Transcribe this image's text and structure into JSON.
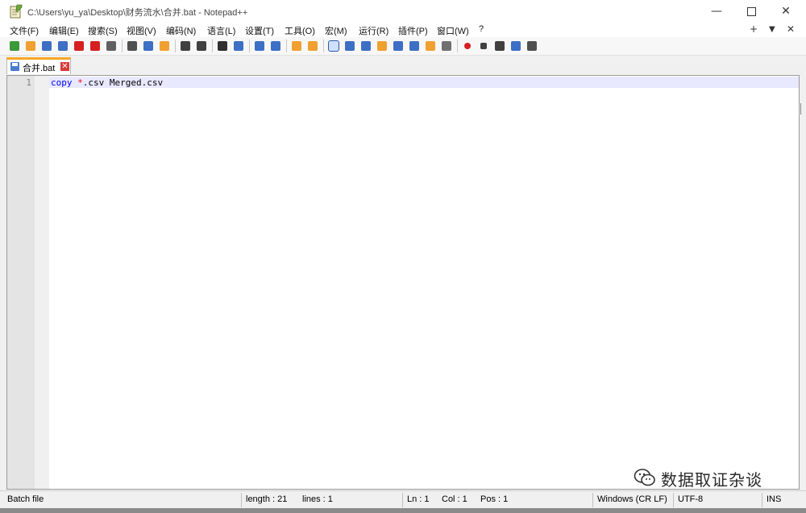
{
  "window": {
    "title": "C:\\Users\\yu_ya\\Desktop\\财务流水\\合并.bat - Notepad++",
    "minimize_glyph": "—",
    "close_glyph": "✕"
  },
  "menu": {
    "items": [
      "文件(F)",
      "编辑(E)",
      "搜索(S)",
      "视图(V)",
      "编码(N)",
      "语言(L)",
      "设置(T)",
      "工具(O)",
      "宏(M)",
      "运行(R)",
      "插件(P)",
      "窗口(W)",
      "?"
    ],
    "right": [
      "+",
      "▼",
      "✕"
    ]
  },
  "toolbar": {
    "icons": [
      "new-file-icon",
      "open-file-icon",
      "save-icon",
      "save-all-icon",
      "close-icon",
      "close-all-icon",
      "print-icon",
      "cut-icon",
      "copy-icon",
      "paste-icon",
      "undo-icon",
      "redo-icon",
      "find-icon",
      "replace-icon",
      "zoom-in-icon",
      "zoom-out-icon",
      "sync-vertical-icon",
      "sync-horizontal-icon",
      "word-wrap-icon",
      "show-all-chars-icon",
      "indent-guide-icon",
      "udl-icon",
      "doc-map-icon",
      "function-list-icon",
      "folder-workspace-icon",
      "monitoring-icon",
      "record-macro-icon",
      "stop-macro-icon",
      "play-macro-icon",
      "run-macro-multiple-icon",
      "save-macro-icon"
    ],
    "colors": {
      "accent_blue": "#3d6fc4",
      "accent_orange": "#f0a030",
      "accent_red": "#d62020",
      "accent_green": "#3a9a3a"
    }
  },
  "tab": {
    "label": "合并.bat",
    "close_glyph": "✕"
  },
  "editor": {
    "line_number": "1",
    "tokens": [
      {
        "text": "copy",
        "kind": "keyword"
      },
      {
        "text": " ",
        "kind": "text"
      },
      {
        "text": "*",
        "kind": "operator"
      },
      {
        "text": ".csv Merged.csv",
        "kind": "text"
      }
    ]
  },
  "statusbar": {
    "language": "Batch file",
    "length": "length : 21",
    "lines": "lines : 1",
    "ln": "Ln : 1",
    "col": "Col : 1",
    "pos": "Pos : 1",
    "eol": "Windows (CR LF)",
    "encoding": "UTF-8",
    "mode": "INS"
  },
  "watermark": {
    "text": "数据取证杂谈"
  }
}
